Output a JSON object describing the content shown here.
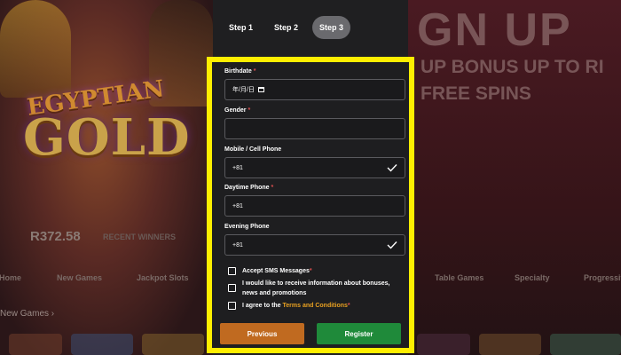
{
  "colors": {
    "highlight": "#ffee00",
    "required": "#e05050",
    "link": "#e8a020",
    "previous": "#c06a20",
    "register": "#1f8a3a"
  },
  "background": {
    "game_logo_line1": "EGYPTIAN",
    "game_logo_line2": "GOLD",
    "jackpot_amount": "R372.58",
    "recent_winners": "RECENT WINNERS",
    "nav_items": [
      "Home",
      "New Games",
      "Jackpot Slots",
      "Table Games",
      "Specialty",
      "Progressive"
    ],
    "new_games_heading": "New Games",
    "hero_line1": "GN UP",
    "hero_line2": "UP BONUS UP TO RI",
    "hero_line3": "FREE SPINS"
  },
  "steps": [
    {
      "label": "Step 1"
    },
    {
      "label": "Step 2"
    },
    {
      "label": "Step 3",
      "active": true
    }
  ],
  "form": {
    "birthdate": {
      "label": "Birthdate",
      "req": "*",
      "value": "年/月/日",
      "icon": "calendar-icon"
    },
    "gender": {
      "label": "Gender",
      "req": "*",
      "value": ""
    },
    "mobile": {
      "label": "Mobile / Cell Phone",
      "value": "+81",
      "icon": "check-icon"
    },
    "daytime": {
      "label": "Daytime Phone",
      "req": "*",
      "value": "+81"
    },
    "evening": {
      "label": "Evening Phone",
      "value": "+81",
      "icon": "check-icon"
    },
    "sms": {
      "label": "Accept SMS Messages",
      "req": "*"
    },
    "bonus_info": {
      "line1": "I would like to receive information about bonuses,",
      "line2": "news and promotions"
    },
    "terms": {
      "prefix": "I agree to the ",
      "link": "Terms and Conditions",
      "req": "*"
    },
    "previous_label": "Previous",
    "register_label": "Register"
  }
}
